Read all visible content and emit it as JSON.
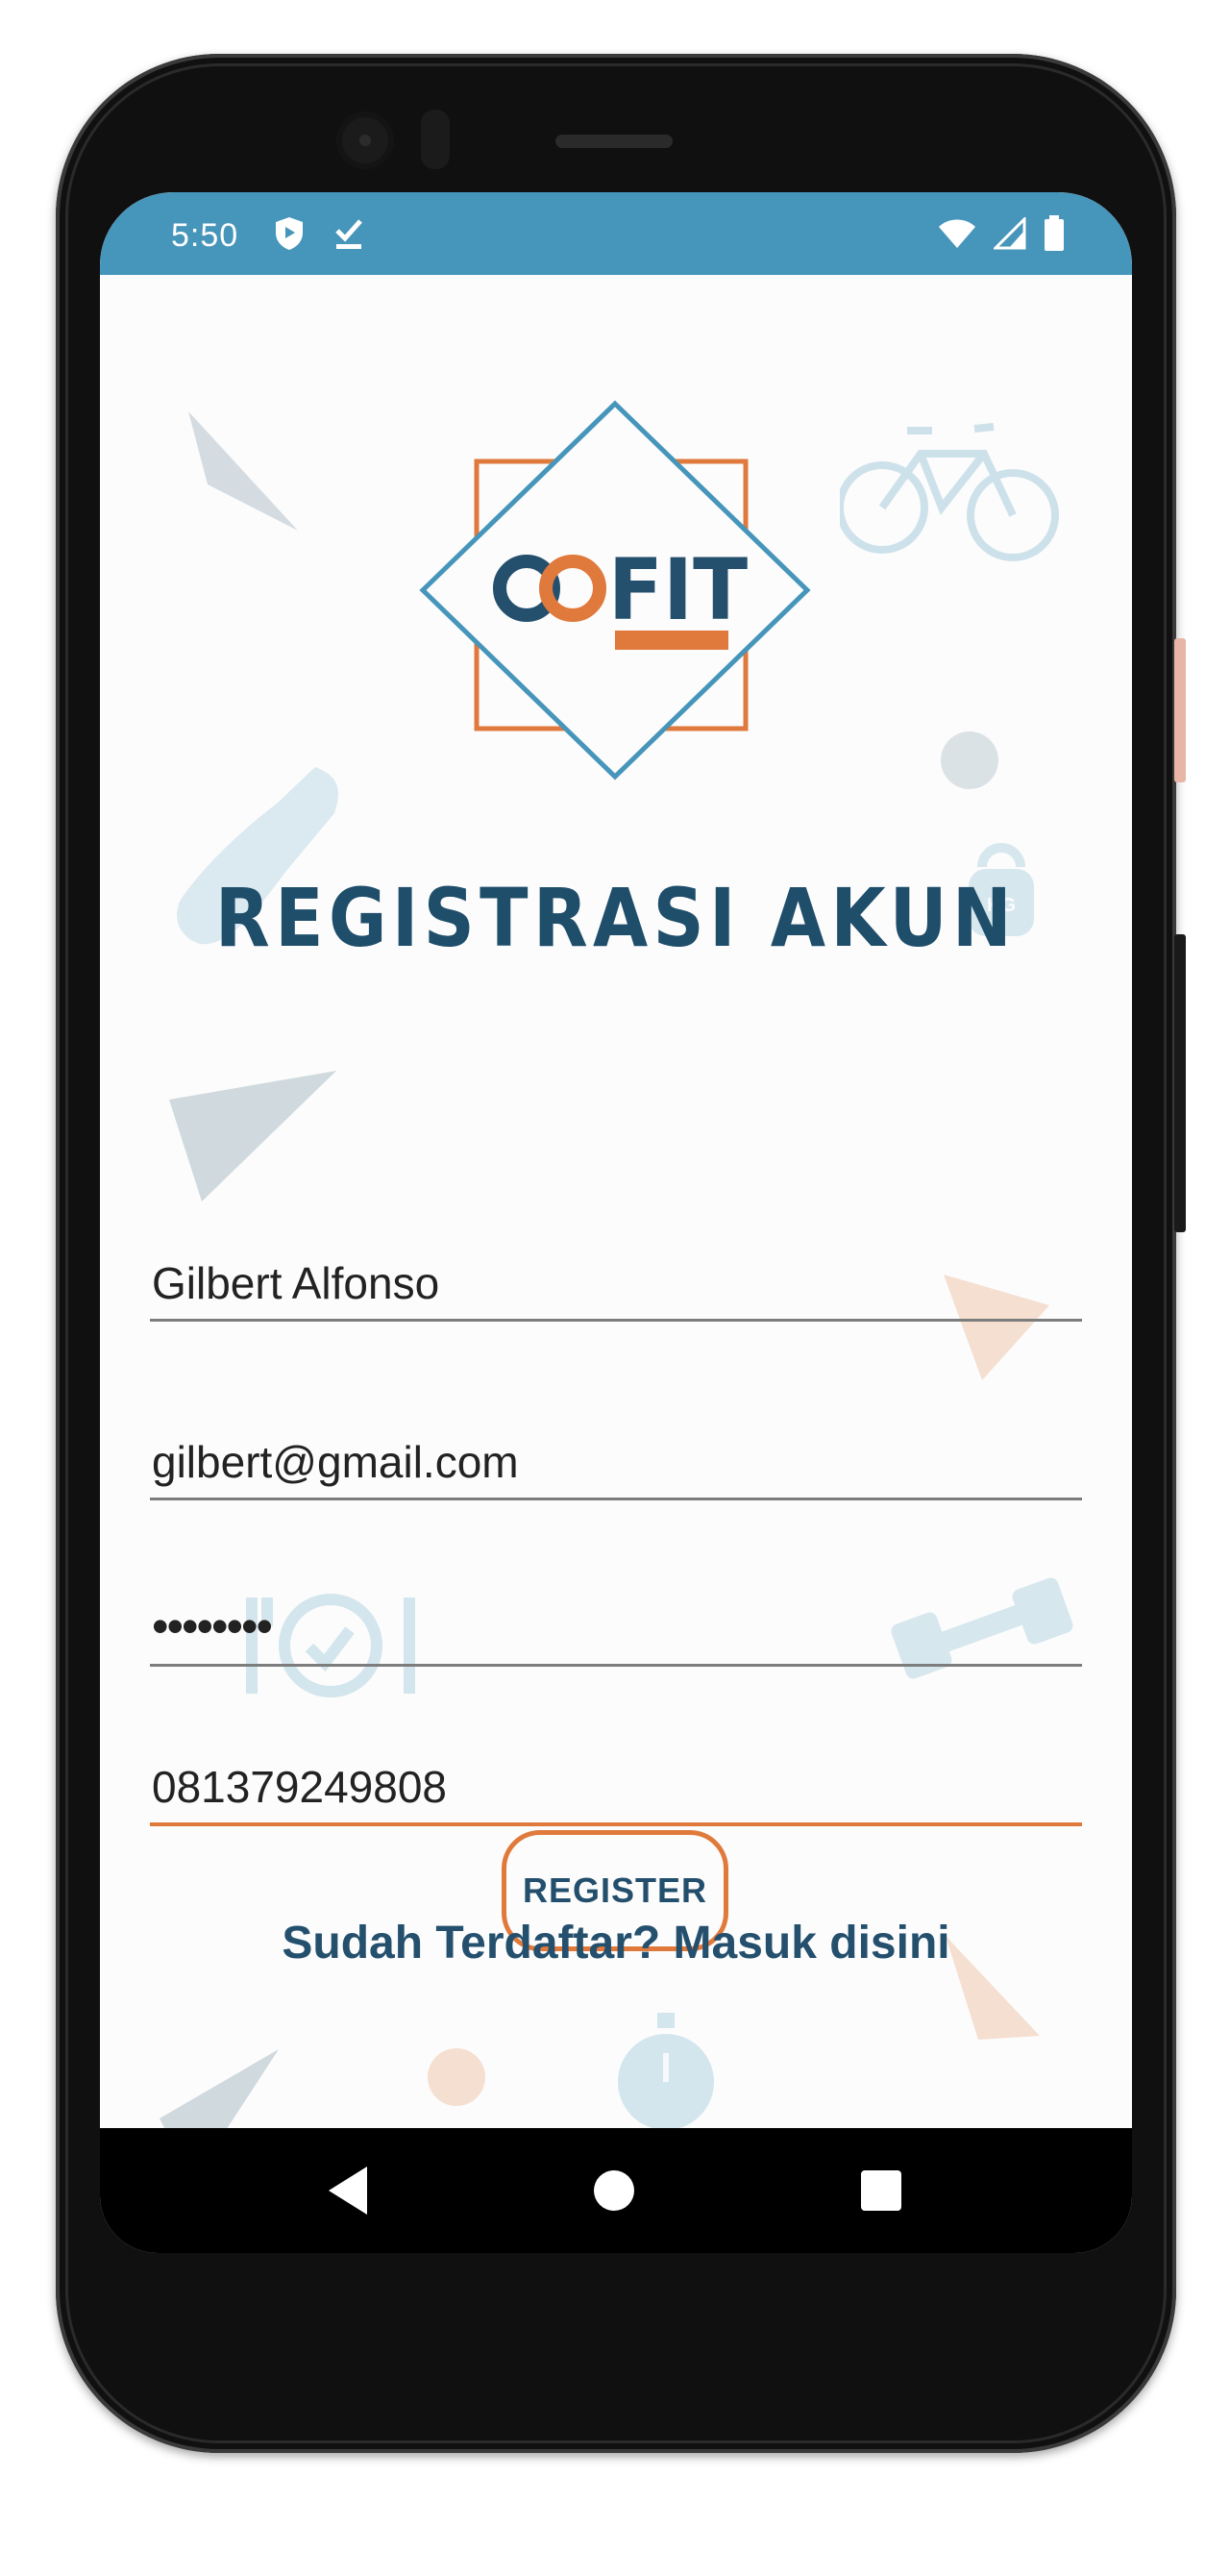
{
  "status_bar": {
    "time": "5:50",
    "icons_left": [
      "shield-play-icon",
      "check-download-icon"
    ],
    "icons_right": [
      "wifi-icon",
      "signal-icon",
      "battery-icon"
    ],
    "color": "#4695ba"
  },
  "logo": {
    "text": "FIT",
    "colors": {
      "primary": "#24506e",
      "accent": "#e07a3c",
      "frame": "#4695ba"
    }
  },
  "page": {
    "title": "REGISTRASI AKUN"
  },
  "form": {
    "name_value": "Gilbert Alfonso",
    "email_value": "gilbert@gmail.com",
    "password_value": "••••••••",
    "phone_value": "081379249808"
  },
  "actions": {
    "register_label": "REGISTER",
    "login_link": "Sudah Terdaftar? Masuk disini"
  },
  "colors": {
    "accent": "#e07a3c",
    "title": "#1f4e6b",
    "background": "#fcfcfc"
  }
}
